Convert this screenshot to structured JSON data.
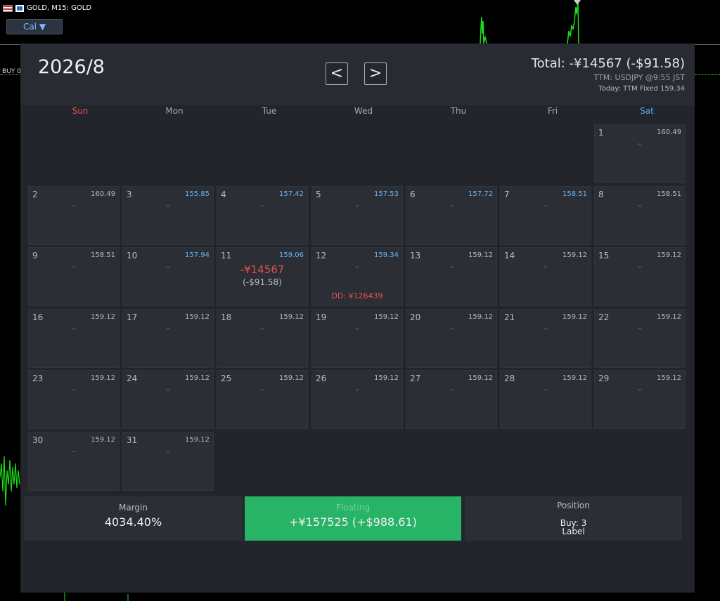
{
  "chart": {
    "symbol_title": "GOLD, M15:  GOLD",
    "cal_button": "Cal ▼",
    "buy_label": "BUY 0"
  },
  "header": {
    "month_title": "2026/8",
    "prev_label": "<",
    "next_label": ">",
    "total": "Total: -¥14567 (-$91.58)",
    "ttm": "TTM: USDJPY @9:55 JST",
    "today": "Today: TTM Fixed 159.34"
  },
  "weekdays": [
    "Sun",
    "Mon",
    "Tue",
    "Wed",
    "Thu",
    "Fri",
    "Sat"
  ],
  "days": [
    {
      "day": "1",
      "col": 6,
      "row": 0,
      "rate": "160.49",
      "blue": false
    },
    {
      "day": "2",
      "col": 0,
      "row": 1,
      "rate": "160.49",
      "blue": false
    },
    {
      "day": "3",
      "col": 1,
      "row": 1,
      "rate": "155.85",
      "blue": true
    },
    {
      "day": "4",
      "col": 2,
      "row": 1,
      "rate": "157.42",
      "blue": true
    },
    {
      "day": "5",
      "col": 3,
      "row": 1,
      "rate": "157.53",
      "blue": true
    },
    {
      "day": "6",
      "col": 4,
      "row": 1,
      "rate": "157.72",
      "blue": true
    },
    {
      "day": "7",
      "col": 5,
      "row": 1,
      "rate": "158.51",
      "blue": true
    },
    {
      "day": "8",
      "col": 6,
      "row": 1,
      "rate": "158.51",
      "blue": false
    },
    {
      "day": "9",
      "col": 0,
      "row": 2,
      "rate": "158.51",
      "blue": false
    },
    {
      "day": "10",
      "col": 1,
      "row": 2,
      "rate": "157.94",
      "blue": true
    },
    {
      "day": "11",
      "col": 2,
      "row": 2,
      "rate": "159.06",
      "blue": true,
      "pnl": "-¥14567",
      "pnl_usd": "(-$91.58)"
    },
    {
      "day": "12",
      "col": 3,
      "row": 2,
      "rate": "159.34",
      "blue": true,
      "dd": "DD: ¥126439"
    },
    {
      "day": "13",
      "col": 4,
      "row": 2,
      "rate": "159.12",
      "blue": false
    },
    {
      "day": "14",
      "col": 5,
      "row": 2,
      "rate": "159.12",
      "blue": false
    },
    {
      "day": "15",
      "col": 6,
      "row": 2,
      "rate": "159.12",
      "blue": false
    },
    {
      "day": "16",
      "col": 0,
      "row": 3,
      "rate": "159.12",
      "blue": false
    },
    {
      "day": "17",
      "col": 1,
      "row": 3,
      "rate": "159.12",
      "blue": false
    },
    {
      "day": "18",
      "col": 2,
      "row": 3,
      "rate": "159.12",
      "blue": false
    },
    {
      "day": "19",
      "col": 3,
      "row": 3,
      "rate": "159.12",
      "blue": false
    },
    {
      "day": "20",
      "col": 4,
      "row": 3,
      "rate": "159.12",
      "blue": false
    },
    {
      "day": "21",
      "col": 5,
      "row": 3,
      "rate": "159.12",
      "blue": false
    },
    {
      "day": "22",
      "col": 6,
      "row": 3,
      "rate": "159.12",
      "blue": false
    },
    {
      "day": "23",
      "col": 0,
      "row": 4,
      "rate": "159.12",
      "blue": false
    },
    {
      "day": "24",
      "col": 1,
      "row": 4,
      "rate": "159.12",
      "blue": false
    },
    {
      "day": "25",
      "col": 2,
      "row": 4,
      "rate": "159.12",
      "blue": false
    },
    {
      "day": "26",
      "col": 3,
      "row": 4,
      "rate": "159.12",
      "blue": false
    },
    {
      "day": "27",
      "col": 4,
      "row": 4,
      "rate": "159.12",
      "blue": false
    },
    {
      "day": "28",
      "col": 5,
      "row": 4,
      "rate": "159.12",
      "blue": false
    },
    {
      "day": "29",
      "col": 6,
      "row": 4,
      "rate": "159.12",
      "blue": false
    },
    {
      "day": "30",
      "col": 0,
      "row": 5,
      "rate": "159.12",
      "blue": false
    },
    {
      "day": "31",
      "col": 1,
      "row": 5,
      "rate": "159.12",
      "blue": false
    }
  ],
  "empty_placeholder": "–",
  "footer": {
    "margin_label": "Margin",
    "margin_value": "4034.40%",
    "floating_label": "Floating",
    "floating_value": "+¥157525 (+$988.61)",
    "position_label": "Position",
    "position_buy": "Buy: 3",
    "position_label2": "Label"
  },
  "colors": {
    "panel": "#22252b",
    "positive_green": "#27b466",
    "negative_red": "#e0524c",
    "rate_blue": "#6ab3f2",
    "chart_green": "#19e019"
  }
}
